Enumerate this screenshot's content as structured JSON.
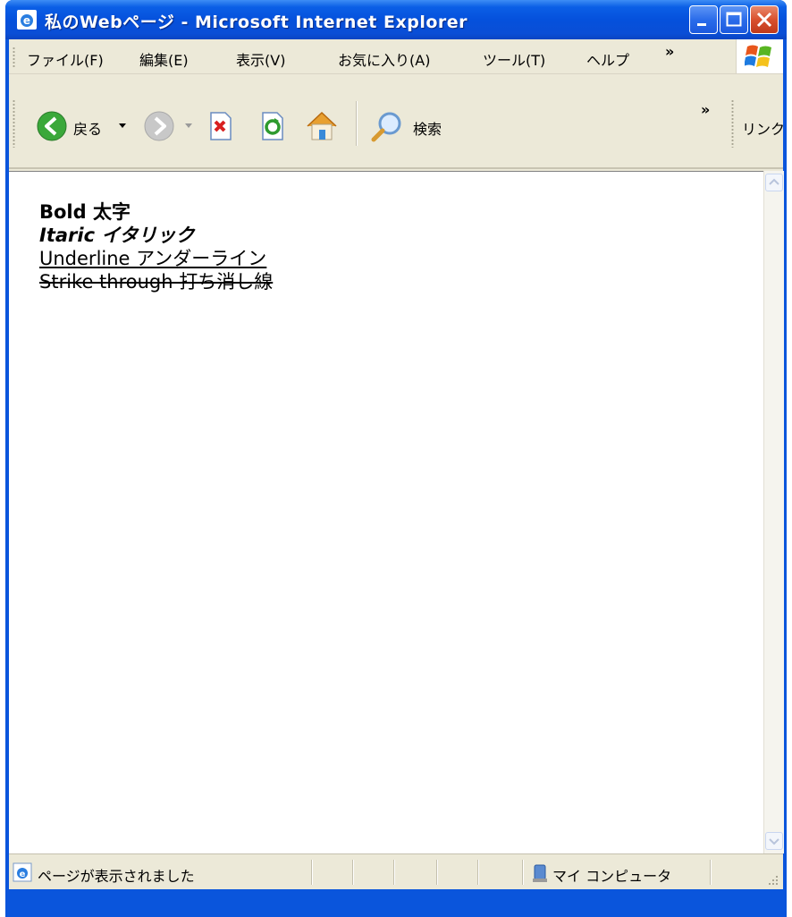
{
  "window": {
    "title": "私のWebページ - Microsoft Internet Explorer"
  },
  "menu": {
    "items": [
      "ファイル(F)",
      "編集(E)",
      "表示(V)",
      "お気に入り(A)",
      "ツール(T)",
      "ヘルプ"
    ],
    "overflow": "»"
  },
  "toolbar": {
    "back_label": "戻る",
    "search_label": "検索",
    "overflow": "»",
    "links_label": "リンク"
  },
  "content": {
    "lines": [
      "Bold 太字",
      "Itaric イタリック",
      "Underline アンダーライン",
      "Strike through 打ち消し線"
    ]
  },
  "status": {
    "message": "ページが表示されました",
    "zone": "マイ コンピュータ"
  },
  "colors": {
    "titlebar": "#0551dc",
    "frame": "#0a55dc",
    "chrome": "#ece9d8"
  }
}
